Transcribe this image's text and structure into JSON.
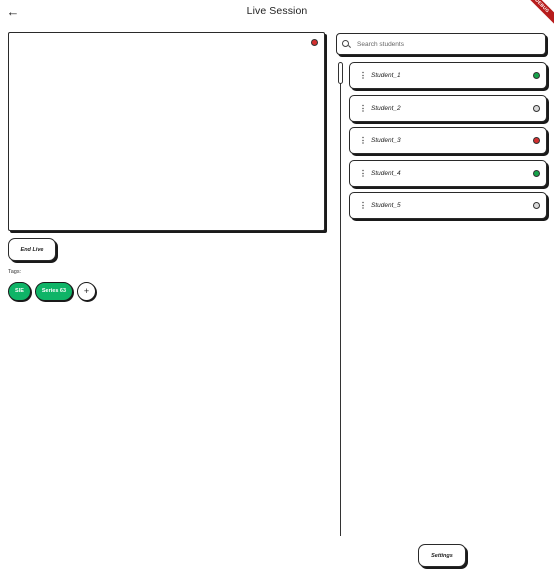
{
  "appbar": {
    "title": "Live Session",
    "back_icon": "arrow-left-icon",
    "back_glyph": "←",
    "debug_banner": "DEBUG",
    "debug_color": "#b71c1c"
  },
  "video": {
    "recording_indicator_color": "#d32f2f"
  },
  "controls": {
    "end_live_label": "End Live",
    "settings_label": "Settings"
  },
  "tags": {
    "label": "Tags:",
    "items": [
      "SIE",
      "Series 63"
    ],
    "add_glyph": "+",
    "chip_color": "#0fb467"
  },
  "search": {
    "placeholder": "Search students",
    "value": ""
  },
  "students": [
    {
      "name": "Student_1",
      "status_color": "#16a34a"
    },
    {
      "name": "Student_2",
      "status_color": "#d9d9d9"
    },
    {
      "name": "Student_3",
      "status_color": "#d32f2f"
    },
    {
      "name": "Student_4",
      "status_color": "#16a34a"
    },
    {
      "name": "Student_5",
      "status_color": "#d9d9d9"
    }
  ],
  "menu_glyph": "⋮"
}
